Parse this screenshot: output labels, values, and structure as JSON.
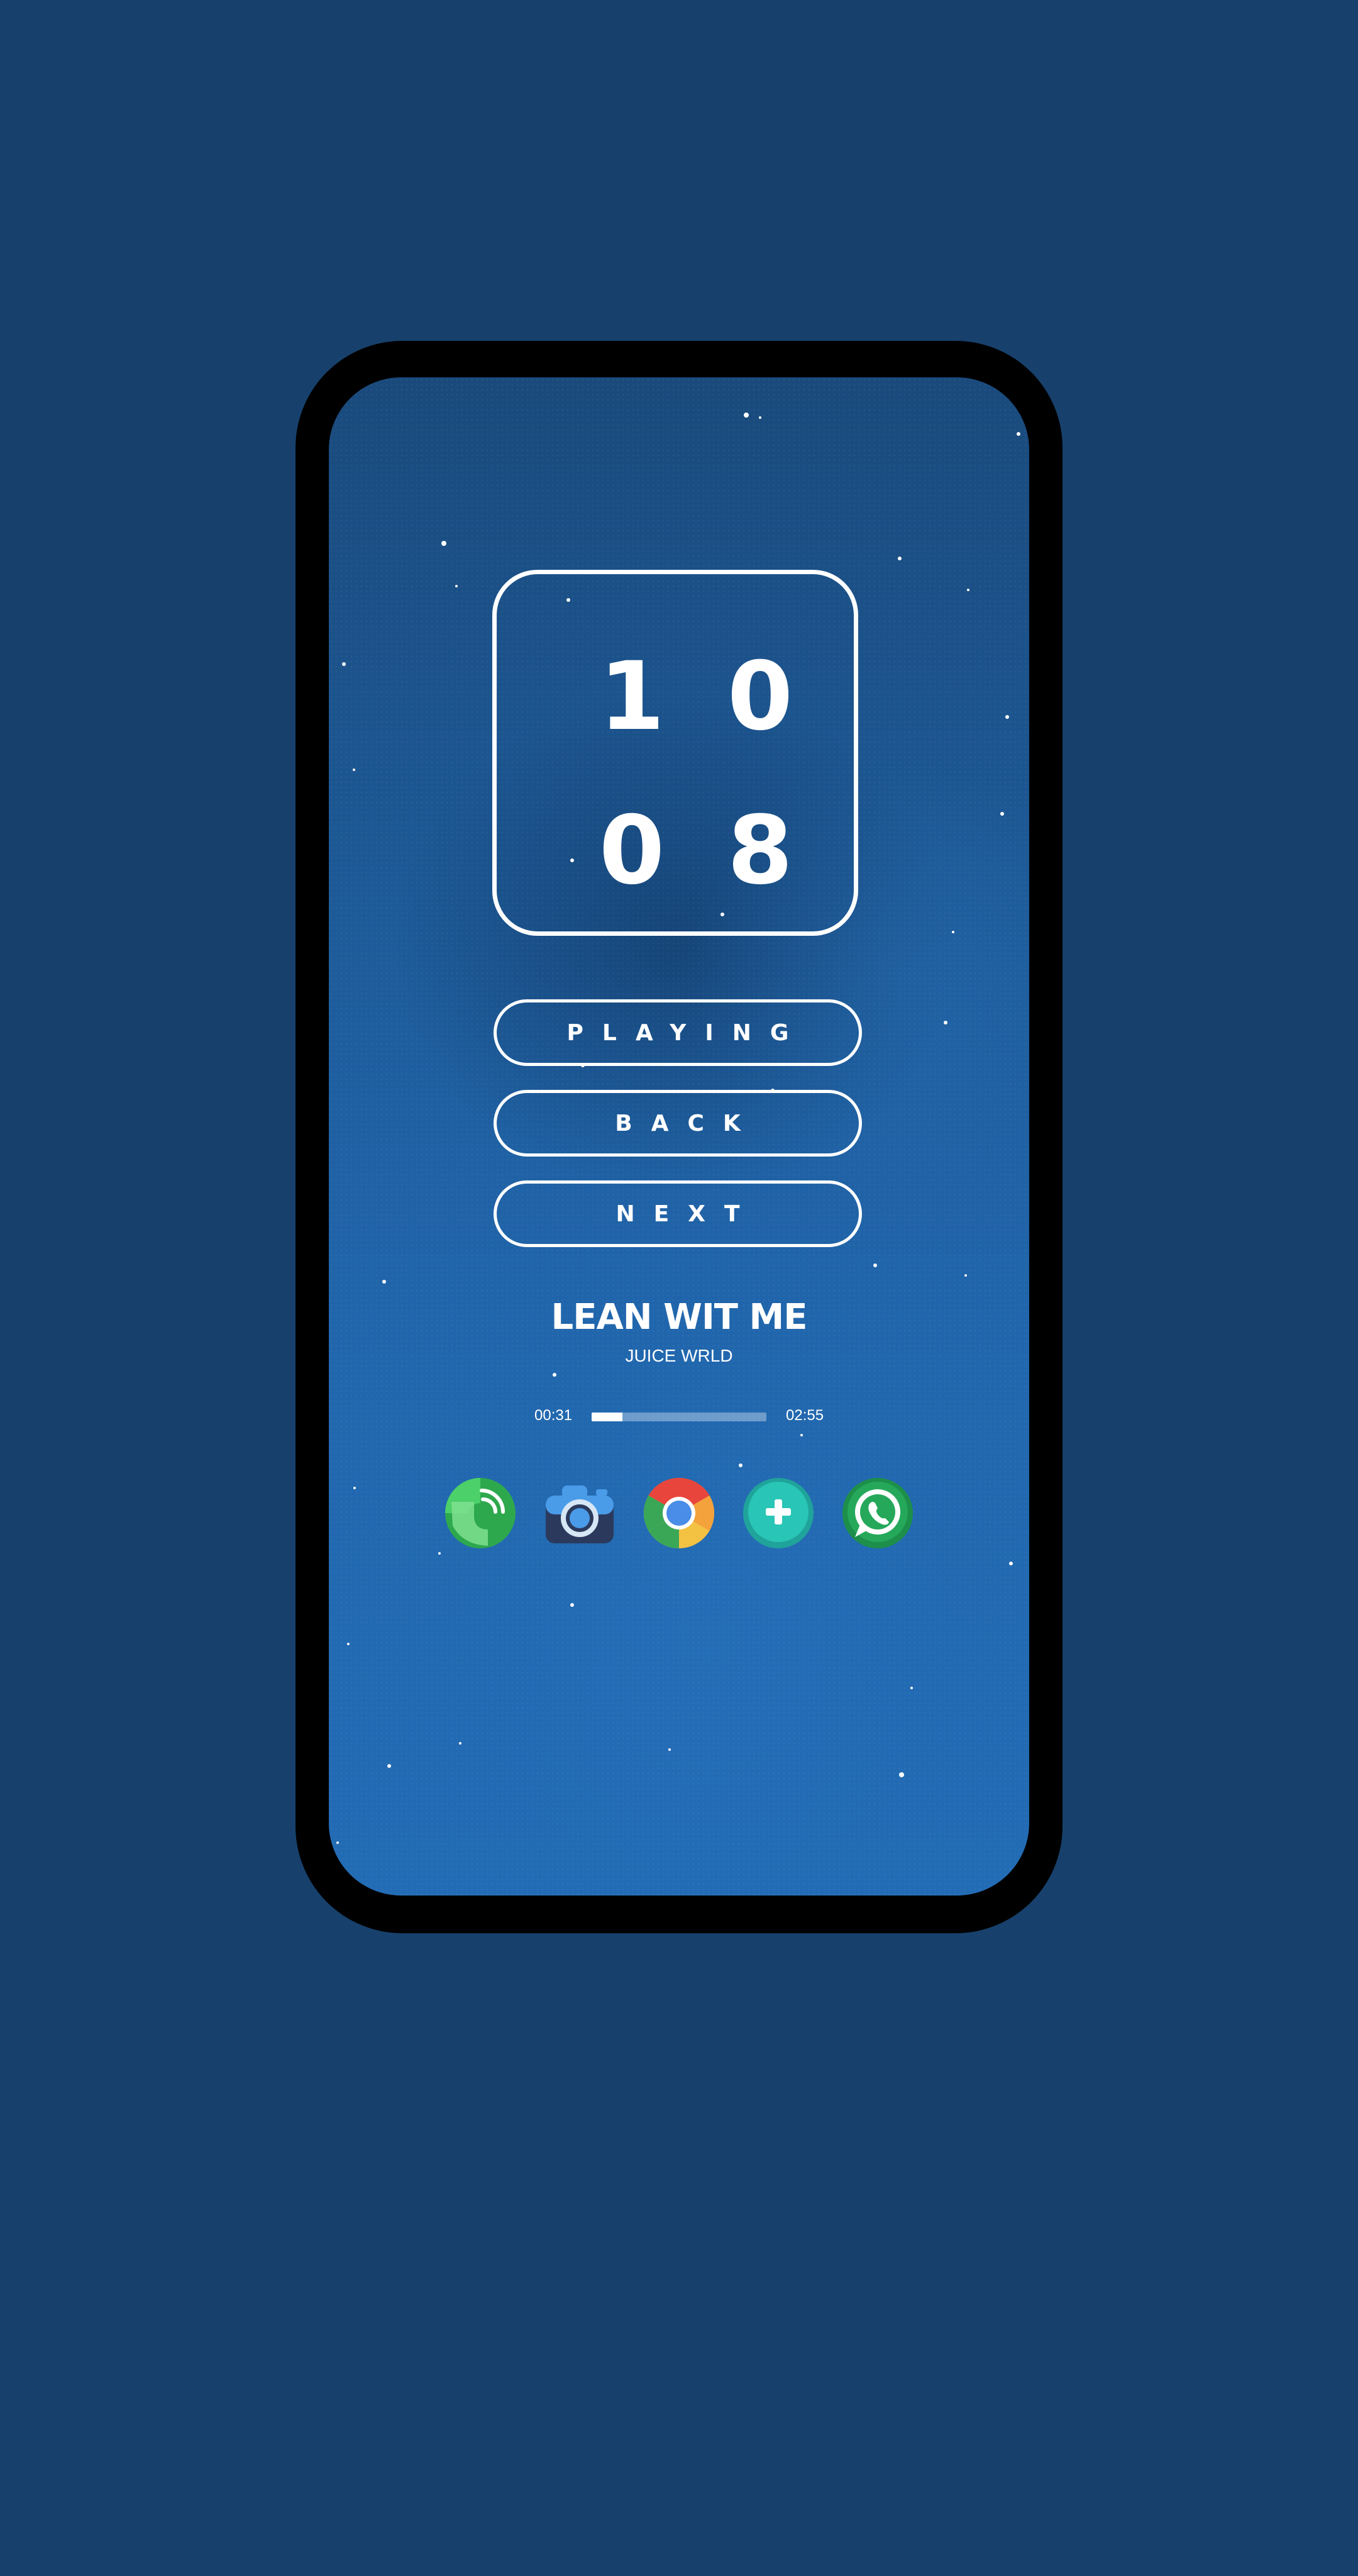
{
  "clock": {
    "digits": [
      "1",
      "0",
      "0",
      "8"
    ]
  },
  "controls": {
    "playing_label": "PLAYING",
    "back_label": "BACK",
    "next_label": "NEXT"
  },
  "track": {
    "title": "LEAN WIT ME",
    "artist": "JUICE WRLD",
    "elapsed": "00:31",
    "duration": "02:55",
    "progress_fraction": 0.177
  },
  "dock": {
    "apps": [
      {
        "icon": "phone-signal-icon"
      },
      {
        "icon": "camera-icon"
      },
      {
        "icon": "chrome-icon"
      },
      {
        "icon": "messenger-plus-icon"
      },
      {
        "icon": "whatsapp-icon"
      }
    ]
  },
  "colors": {
    "background": "#17416c",
    "screen_top": "#1a4a7c",
    "screen_bottom": "#226cb5",
    "foreground": "#ffffff"
  }
}
